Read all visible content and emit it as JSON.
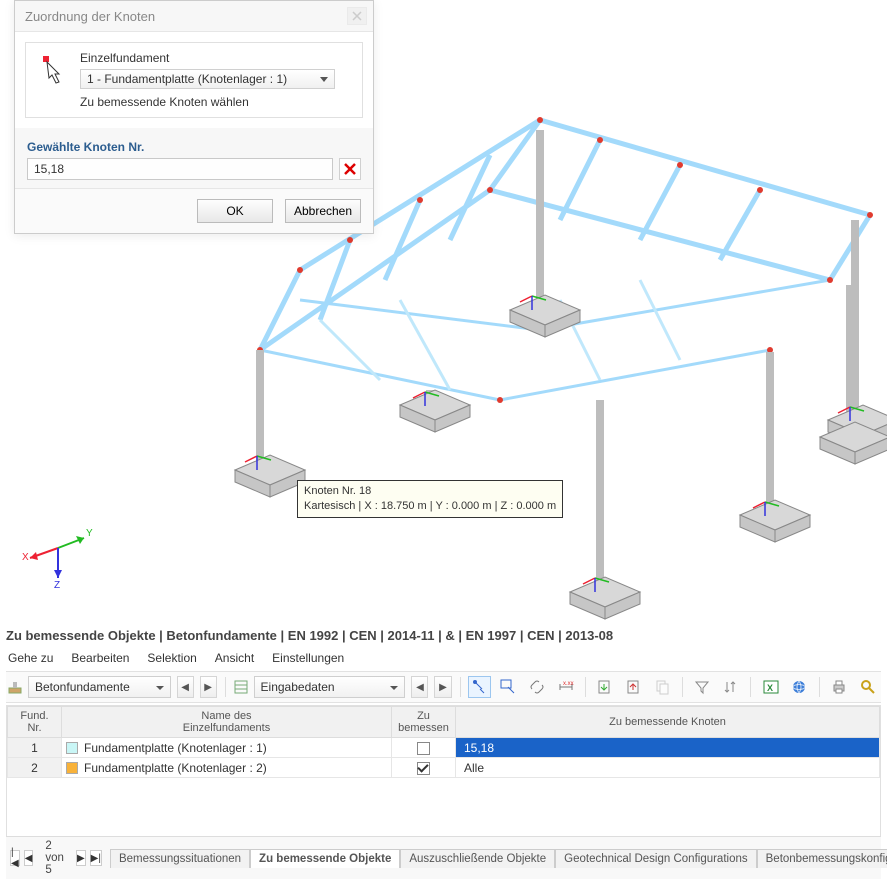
{
  "dialog": {
    "title": "Zuordnung der Knoten",
    "fund_label": "Einzelfundament",
    "fund_value": "1 - Fundamentplatte (Knotenlager : 1)",
    "hint": "Zu bemessende Knoten wählen",
    "section_label": "Gewählte Knoten Nr.",
    "input_value": "15,18",
    "ok": "OK",
    "cancel": "Abbrechen"
  },
  "tooltip": {
    "line1": "Knoten Nr. 18",
    "line2": "Kartesisch | X : 18.750 m | Y : 0.000 m | Z : 0.000 m"
  },
  "axis": {
    "x": "X",
    "y": "Y",
    "z": "Z"
  },
  "panel": {
    "title": "Zu bemessende Objekte | Betonfundamente | EN 1992 | CEN | 2014-11 | & | EN 1997 | CEN | 2013-08",
    "menu": [
      "Gehe zu",
      "Bearbeiten",
      "Selektion",
      "Ansicht",
      "Einstellungen"
    ],
    "combo1": "Betonfundamente",
    "combo2": "Eingabedaten",
    "grid": {
      "headers": {
        "nr": "Fund.\nNr.",
        "name": "Name des\nEinzelfundaments",
        "bem": "Zu\nbemessen",
        "knoten": "Zu bemessende Knoten"
      },
      "rows": [
        {
          "nr": "1",
          "color": "#c9f6f6",
          "name": "Fundamentplatte (Knotenlager : 1)",
          "bem": false,
          "knoten": "15,18",
          "selected": true
        },
        {
          "nr": "2",
          "color": "#f8b23a",
          "name": "Fundamentplatte (Knotenlager : 2)",
          "bem": true,
          "knoten": "Alle",
          "selected": false
        }
      ]
    },
    "tab_counter": "2 von 5",
    "tabs": [
      {
        "label": "Bemessungssituationen",
        "active": false
      },
      {
        "label": "Zu bemessende Objekte",
        "active": true
      },
      {
        "label": "Auszuschließende Objekte",
        "active": false
      },
      {
        "label": "Geotechnical Design Configurations",
        "active": false
      },
      {
        "label": "Betonbemessungskonfigurationen",
        "active": false
      }
    ]
  }
}
